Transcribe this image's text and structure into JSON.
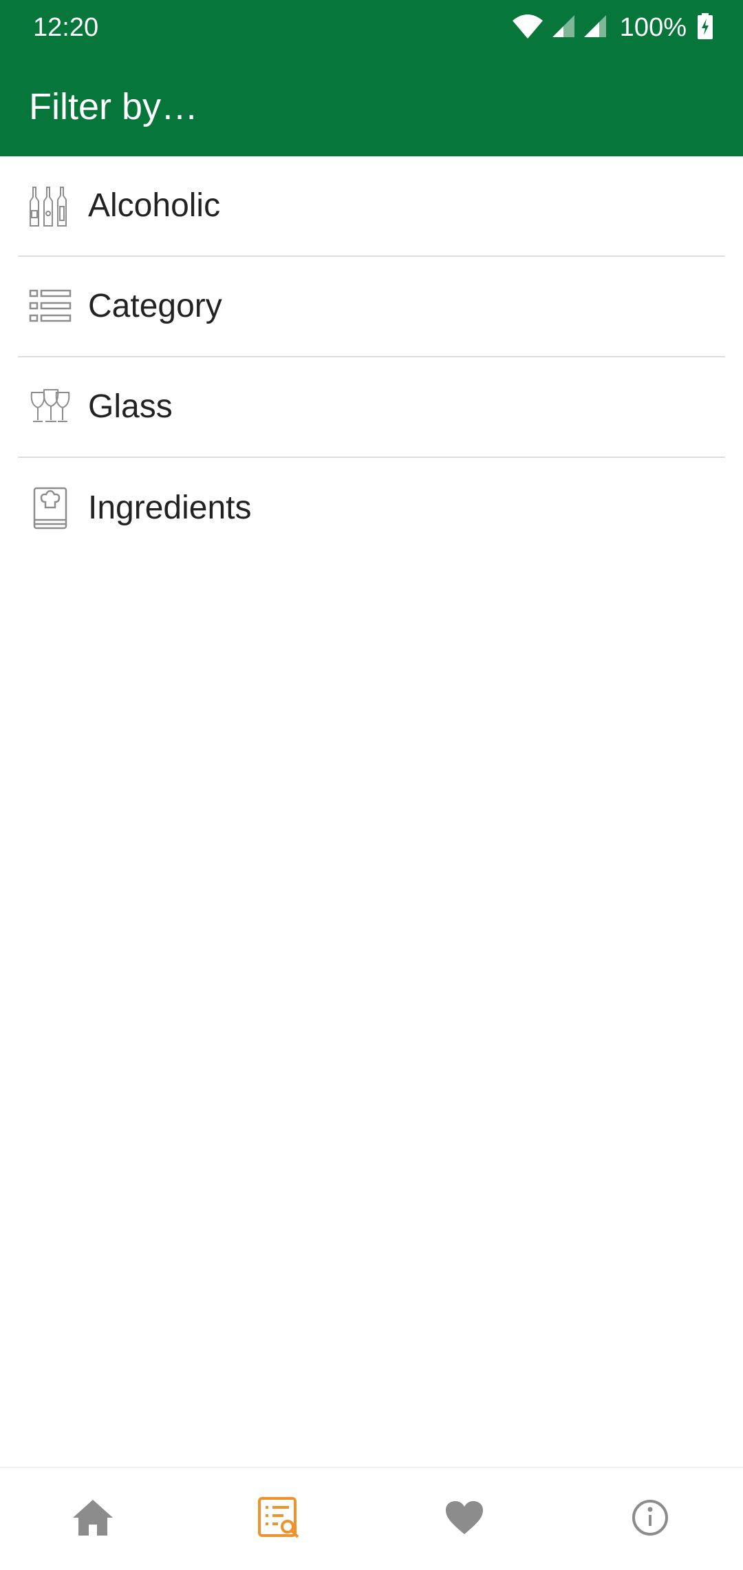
{
  "status_bar": {
    "time": "12:20",
    "battery_percent": "100%",
    "icons": [
      "wifi-icon",
      "signal-icon",
      "signal-icon",
      "battery-charging-icon"
    ]
  },
  "app_bar": {
    "title": "Filter by…"
  },
  "filters": [
    {
      "label": "Alcoholic",
      "icon": "bottles-icon"
    },
    {
      "label": "Category",
      "icon": "list-icon"
    },
    {
      "label": "Glass",
      "icon": "glasses-icon"
    },
    {
      "label": "Ingredients",
      "icon": "recipe-book-icon"
    }
  ],
  "bottom_nav": {
    "items": [
      {
        "icon": "home-icon",
        "selected": false
      },
      {
        "icon": "search-list-icon",
        "selected": true
      },
      {
        "icon": "heart-icon",
        "selected": false
      },
      {
        "icon": "info-icon",
        "selected": false
      }
    ]
  },
  "colors": {
    "primary": "#06763a",
    "accent": "#f0912b",
    "icon_inactive": "#8c8c8c",
    "divider": "#dddddd"
  }
}
